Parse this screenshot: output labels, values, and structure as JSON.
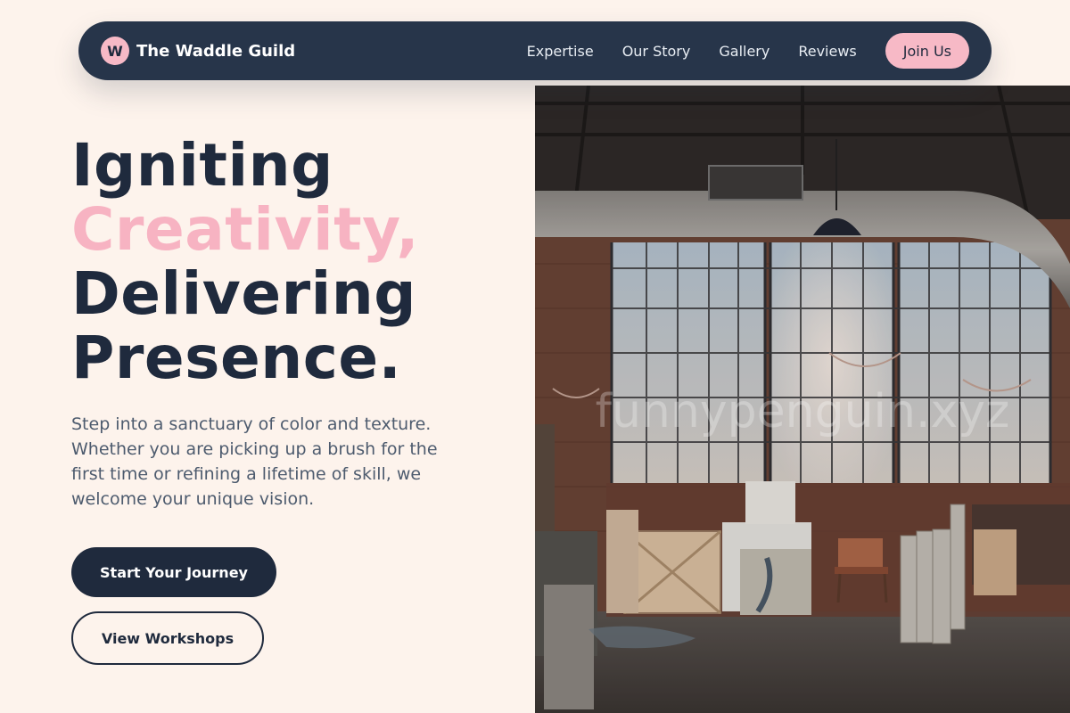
{
  "nav": {
    "logo_letter": "W",
    "brand": "The Waddle Guild",
    "links": [
      "Expertise",
      "Our Story",
      "Gallery",
      "Reviews"
    ],
    "cta": "Join Us"
  },
  "hero": {
    "title_line1": "Igniting",
    "title_line2": "Creativity,",
    "title_line3": "Delivering",
    "title_line4": "Presence.",
    "description": "Step into a sanctuary of color and texture. Whether you are picking up a brush for the first time or refining a lifetime of skill, we welcome your unique vision.",
    "primary_button": "Start Your Journey",
    "secondary_button": "View Workshops",
    "image_watermark": "funnypenguin.xyz"
  },
  "colors": {
    "navy": "#1f2a3d",
    "nav_bg": "#27354a",
    "accent_pink": "#f7b9c6",
    "background": "#fdf3ec",
    "body_text": "#4d5b6e"
  }
}
